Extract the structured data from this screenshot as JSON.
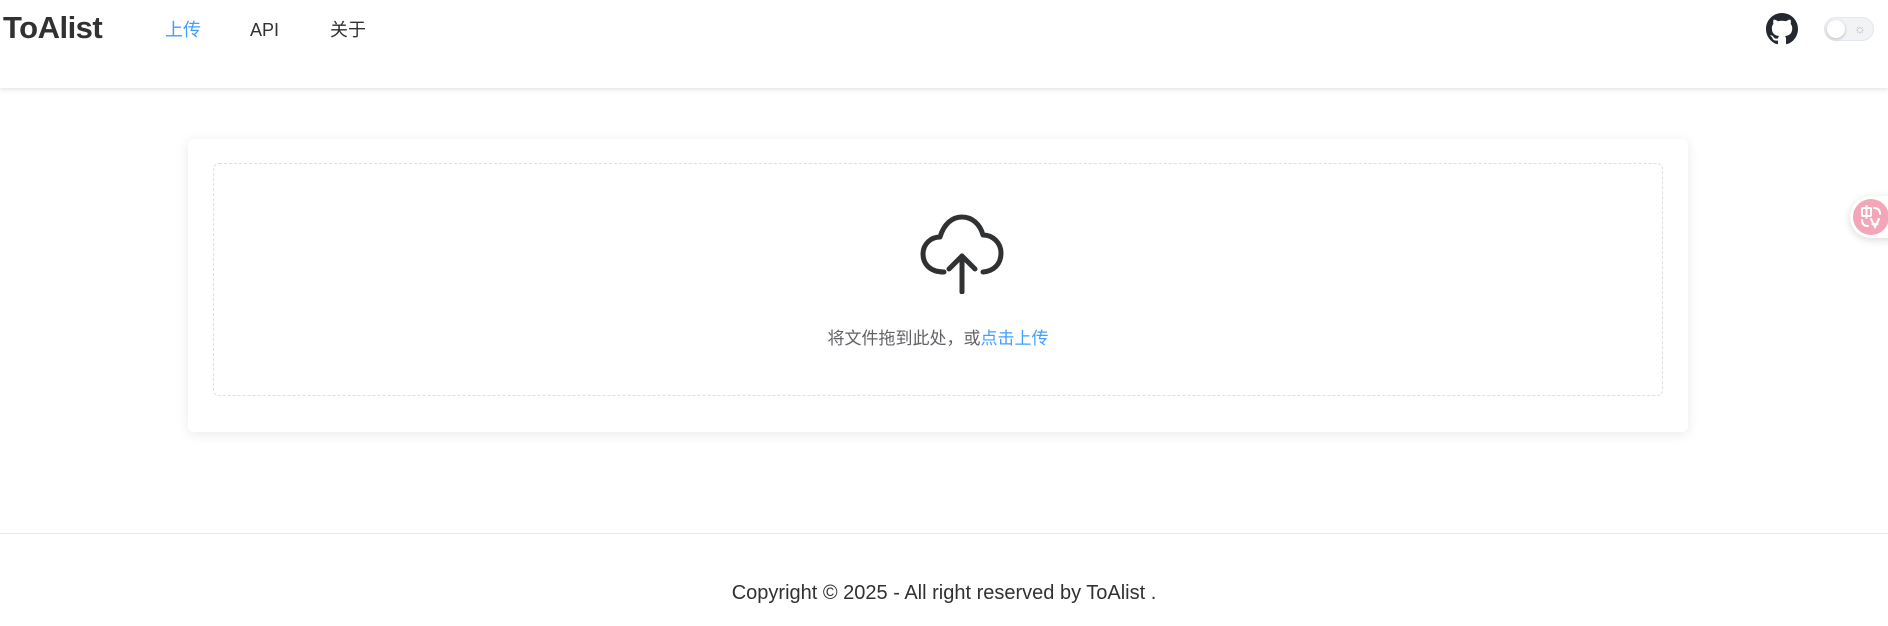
{
  "header": {
    "brand": "ToAlist",
    "nav": [
      {
        "label": "上传",
        "active": true
      },
      {
        "label": "API",
        "active": false
      },
      {
        "label": "关于",
        "active": false
      }
    ],
    "github_icon": "github-icon",
    "theme_toggle": {
      "state": "light",
      "icon": "sun-icon"
    }
  },
  "upload": {
    "icon": "cloud-upload-icon",
    "text": "将文件拖到此处，或",
    "link": "点击上传"
  },
  "translate_widget": {
    "icon": "translate-icon"
  },
  "footer": {
    "copyright": "Copyright © 2025 - All right reserved by ToAlist ."
  },
  "colors": {
    "accent": "#409eff",
    "text": "#303133",
    "muted": "#606266",
    "border": "#dcdfe6"
  }
}
